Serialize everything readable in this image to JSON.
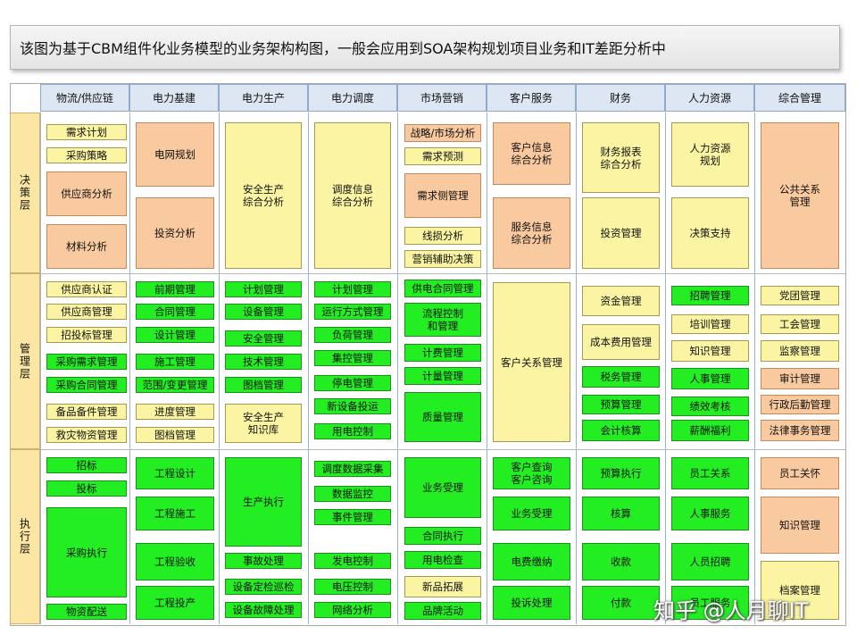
{
  "title": "该图为基于CBM组件化业务模型的业务架构构图，一般会应用到SOA架构规划项目业务和IT差距分析中",
  "columns": [
    "物流/供应链",
    "电力基建",
    "电力生产",
    "电力调度",
    "市场营销",
    "客户服务",
    "财务",
    "人力资源",
    "综合管理"
  ],
  "rows": [
    "决策层",
    "管理层",
    "执行层"
  ],
  "colors": {
    "orange": "#f9c9a0",
    "yellow": "#fbf5a3",
    "green": "#22ee22",
    "header": "#dde6f3",
    "row_header": "#fbe7a3"
  },
  "cells": {
    "c0": [
      "需求计划",
      "采购策略",
      "供应商分析",
      "材料分析",
      "供应商认证",
      "供应商管理",
      "招投标管理",
      "采购需求管理",
      "采购合同管理",
      "备品备件管理",
      "救灾物资管理",
      "招标",
      "投标",
      "采购执行",
      "物资配送"
    ],
    "c1": [
      "电网规划",
      "投资分析",
      "前期管理",
      "合同管理",
      "设计管理",
      "施工管理",
      "范围/变更管理",
      "进度管理",
      "图档管理",
      "工程设计",
      "工程施工",
      "工程验收",
      "工程投产"
    ],
    "c2": [
      "安全生产\n综合分析",
      "计划管理",
      "设备管理",
      "安全管理",
      "技术管理",
      "图档管理",
      "安全生产\n知识库",
      "生产执行",
      "事故处理",
      "设备定检巡检",
      "设备故障处理"
    ],
    "c3": [
      "调度信息\n综合分析",
      "计划管理",
      "运行方式管理",
      "负荷管理",
      "集控管理",
      "停电管理",
      "新设备投运",
      "用电控制",
      "调度数据采集",
      "数据监控",
      "事件管理",
      "发电控制",
      "电压控制",
      "网络分析"
    ],
    "c4": [
      "战略/市场分析",
      "需求预测",
      "需求侧管理",
      "线损分析",
      "营销辅助决策",
      "供电合同管理",
      "流程控制\n和管理",
      "计费管理",
      "计量管理",
      "质量管理",
      "业务受理",
      "合同执行",
      "用电检查",
      "新品拓展",
      "品牌活动"
    ],
    "c5": [
      "客户信息\n综合分析",
      "服务信息\n综合分析",
      "客户关系管理",
      "客户查询\n客户咨询",
      "业务受理",
      "电费缴纳",
      "投诉处理"
    ],
    "c6": [
      "财务报表\n综合分析",
      "投资管理",
      "资金管理",
      "成本费用管理",
      "税务管理",
      "预算管理",
      "会计核算",
      "预算执行",
      "核算",
      "收款",
      "付款"
    ],
    "c7": [
      "人力资源\n规划",
      "决策支持",
      "招聘管理",
      "培训管理",
      "知识管理",
      "人事管理",
      "绩效考核",
      "薪酬福利",
      "员工关系",
      "人事服务",
      "人员招聘",
      "员工服务"
    ],
    "c8": [
      "公共关系\n管理",
      "党团管理",
      "工会管理",
      "监察管理",
      "审计管理",
      "行政后勤管理",
      "法律事务管理",
      "员工关怀",
      "知识管理",
      "档案管理"
    ]
  },
  "watermark": "知乎 @人月聊IT"
}
